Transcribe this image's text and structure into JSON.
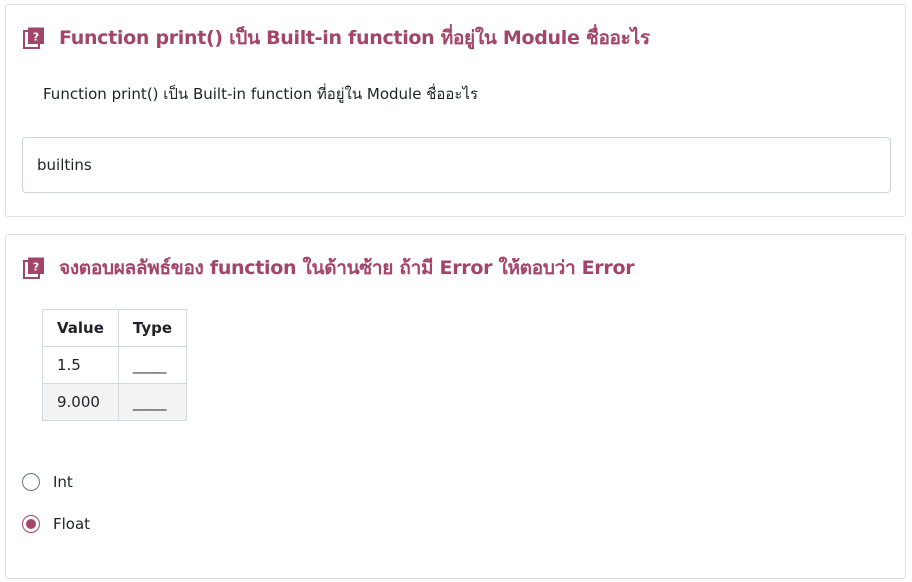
{
  "colors": {
    "accent": "#a3456a",
    "border": "#dcdfe3"
  },
  "question1": {
    "icon": "question-book-icon",
    "title": "Function print() เป็น Built-in function ที่อยู่ใน Module ชื่ออะไร",
    "text": "Function print() เป็น Built-in function ที่อยู่ใน Module ชื่ออะไร",
    "answer_value": "builtins"
  },
  "question2": {
    "icon": "question-book-icon",
    "title": "จงตอบผลลัพธ์ของ function ในด้านซ้าย ถ้ามี Error ให้ตอบว่า Error",
    "table": {
      "headers": [
        "Value",
        "Type"
      ],
      "rows": [
        [
          "1.5",
          "_____"
        ],
        [
          "9.000",
          "_____"
        ]
      ]
    },
    "options": [
      {
        "label": "Int",
        "checked": false
      },
      {
        "label": "Float",
        "checked": true
      }
    ]
  }
}
